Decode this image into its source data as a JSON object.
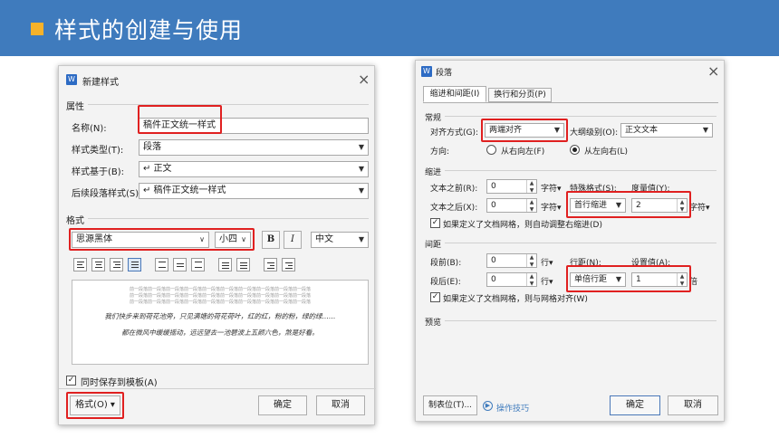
{
  "banner": {
    "title": "样式的创建与使用"
  },
  "left": {
    "title": "新建样式",
    "section_props": "属性",
    "name_label": "名称(N):",
    "name_value": "稿件正文统一样式",
    "type_label": "样式类型(T):",
    "type_value": "段落",
    "based_label": "样式基于(B):",
    "based_value": "↵ 正文",
    "next_label": "后续段落样式(S):",
    "next_value": "↵ 稿件正文统一样式",
    "section_format": "格式",
    "font_value": "思源黑体",
    "size_value": "小四",
    "bold": "B",
    "italic": "I",
    "lang_value": "中文",
    "preview_prev": "前一段落前一段落前一段落前一段落前一段落前一段落前一段落前一段落前一段落前一段落",
    "preview_line1": "我们快步来到荷花池旁，只见满塘的荷花荷叶，红的红，粉的粉，绿的绿……",
    "preview_line2": "都在微风中缓缓摇动，远远望去一池碧波上五颜六色，煞是好看。",
    "template_check": "同时保存到模板(A)",
    "format_btn": "格式(O) ▾",
    "ok": "确定",
    "cancel": "取消"
  },
  "right": {
    "title": "段落",
    "tab1": "缩进和间距(I)",
    "tab2": "换行和分页(P)",
    "sec_general": "常规",
    "align_label": "对齐方式(G):",
    "align_value": "两端对齐",
    "outline_label": "大纲级别(O):",
    "outline_value": "正文文本",
    "dir_label": "方向:",
    "dir_rtl": "从右向左(F)",
    "dir_ltr": "从左向右(L)",
    "sec_indent": "缩进",
    "before_text": "文本之前(R):",
    "before_val": "0",
    "unit_char": "字符▾",
    "special_label": "特殊格式(S):",
    "special_value": "首行缩进",
    "degree_label": "度量值(Y):",
    "degree_value": "2",
    "after_text": "文本之后(X):",
    "after_val": "0",
    "grid_indent": "如果定义了文档网格，则自动调整右缩进(D)",
    "sec_spacing": "间距",
    "sp_before": "段前(B):",
    "sp_before_val": "0",
    "unit_line": "行▾",
    "line_label": "行距(N):",
    "line_value": "单倍行距",
    "set_label": "设置值(A):",
    "set_value": "1",
    "unit_bei": "倍",
    "sp_after": "段后(E):",
    "sp_after_val": "0",
    "grid_align": "如果定义了文档网格，则与网格对齐(W)",
    "sec_preview": "预览",
    "tabs_btn": "制表位(T)...",
    "tips": "操作技巧",
    "ok": "确定",
    "cancel": "取消"
  }
}
